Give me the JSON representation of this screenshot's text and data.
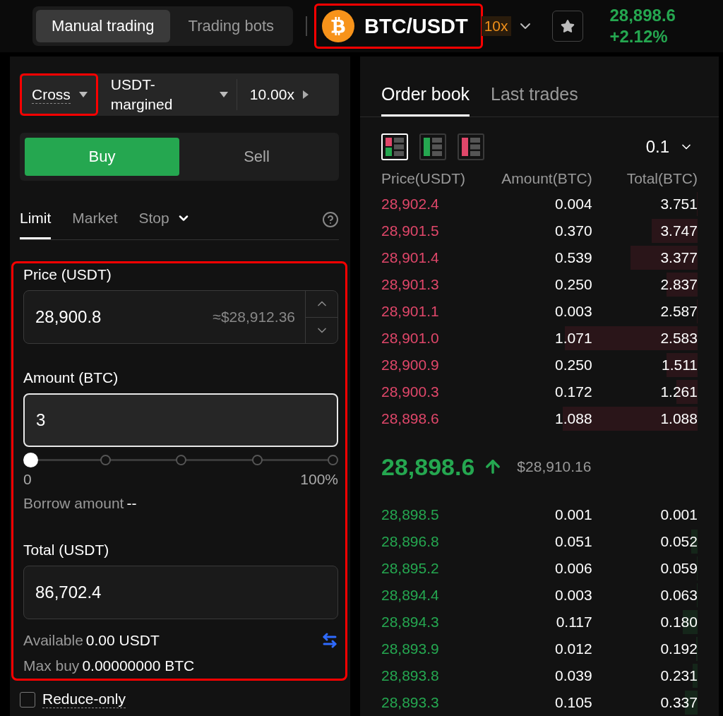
{
  "header": {
    "modes": [
      {
        "label": "Manual trading",
        "selected": true
      },
      {
        "label": "Trading bots",
        "selected": false
      }
    ],
    "pair": {
      "symbol": "BTC/USDT",
      "highlighted": true
    },
    "leverage_badge": "10x",
    "last_price": "28,898.6",
    "change": "+2.12%"
  },
  "order_form": {
    "margin_mode": {
      "label": "Cross",
      "highlighted": true
    },
    "margin_type": "USDT-margined",
    "leverage": "10.00x",
    "sides": [
      {
        "label": "Buy",
        "selected": true
      },
      {
        "label": "Sell",
        "selected": false
      }
    ],
    "order_types": [
      {
        "label": "Limit",
        "selected": true
      },
      {
        "label": "Market",
        "selected": false
      },
      {
        "label": "Stop",
        "selected": false
      }
    ],
    "highlighted": true,
    "price": {
      "label": "Price (USDT)",
      "value": "28,900.8",
      "hint": "≈$28,912.36"
    },
    "amount": {
      "label": "Amount (BTC)",
      "value": "3",
      "focused": true
    },
    "slider": {
      "level": 0,
      "min_label": "0",
      "max_label": "100%"
    },
    "borrow": {
      "label": "Borrow amount",
      "value": "--"
    },
    "total": {
      "label": "Total (USDT)",
      "value": "86,702.4"
    },
    "available": {
      "label": "Available",
      "value": "0.00 USDT"
    },
    "max_buy": {
      "label": "Max buy",
      "value": "0.00000000 BTC"
    },
    "reduce_only": {
      "label": "Reduce-only",
      "checked": false
    }
  },
  "order_book": {
    "tabs": [
      {
        "label": "Order book",
        "selected": true
      },
      {
        "label": "Last trades",
        "selected": false
      }
    ],
    "views": [
      {
        "kind": "both",
        "selected": true
      },
      {
        "kind": "bids",
        "selected": false
      },
      {
        "kind": "asks",
        "selected": false
      }
    ],
    "precision": "0.1",
    "columns": [
      "Price(USDT)",
      "Amount(BTC)",
      "Total(BTC)"
    ],
    "asks": [
      {
        "price": "28,902.4",
        "amount": "0.004",
        "total": "3.751"
      },
      {
        "price": "28,901.5",
        "amount": "0.370",
        "total": "3.747"
      },
      {
        "price": "28,901.4",
        "amount": "0.539",
        "total": "3.377"
      },
      {
        "price": "28,901.3",
        "amount": "0.250",
        "total": "2.837"
      },
      {
        "price": "28,901.1",
        "amount": "0.003",
        "total": "2.587"
      },
      {
        "price": "28,901.0",
        "amount": "1.071",
        "total": "2.583"
      },
      {
        "price": "28,900.9",
        "amount": "0.250",
        "total": "1.511"
      },
      {
        "price": "28,900.3",
        "amount": "0.172",
        "total": "1.261"
      },
      {
        "price": "28,898.6",
        "amount": "1.088",
        "total": "1.088"
      }
    ],
    "mid": {
      "price": "28,898.6",
      "usd": "$28,910.16"
    },
    "bids": [
      {
        "price": "28,898.5",
        "amount": "0.001",
        "total": "0.001"
      },
      {
        "price": "28,896.8",
        "amount": "0.051",
        "total": "0.052"
      },
      {
        "price": "28,895.2",
        "amount": "0.006",
        "total": "0.059"
      },
      {
        "price": "28,894.4",
        "amount": "0.003",
        "total": "0.063"
      },
      {
        "price": "28,894.3",
        "amount": "0.117",
        "total": "0.180"
      },
      {
        "price": "28,893.9",
        "amount": "0.012",
        "total": "0.192"
      },
      {
        "price": "28,893.8",
        "amount": "0.039",
        "total": "0.231"
      },
      {
        "price": "28,893.3",
        "amount": "0.105",
        "total": "0.337"
      }
    ]
  }
}
